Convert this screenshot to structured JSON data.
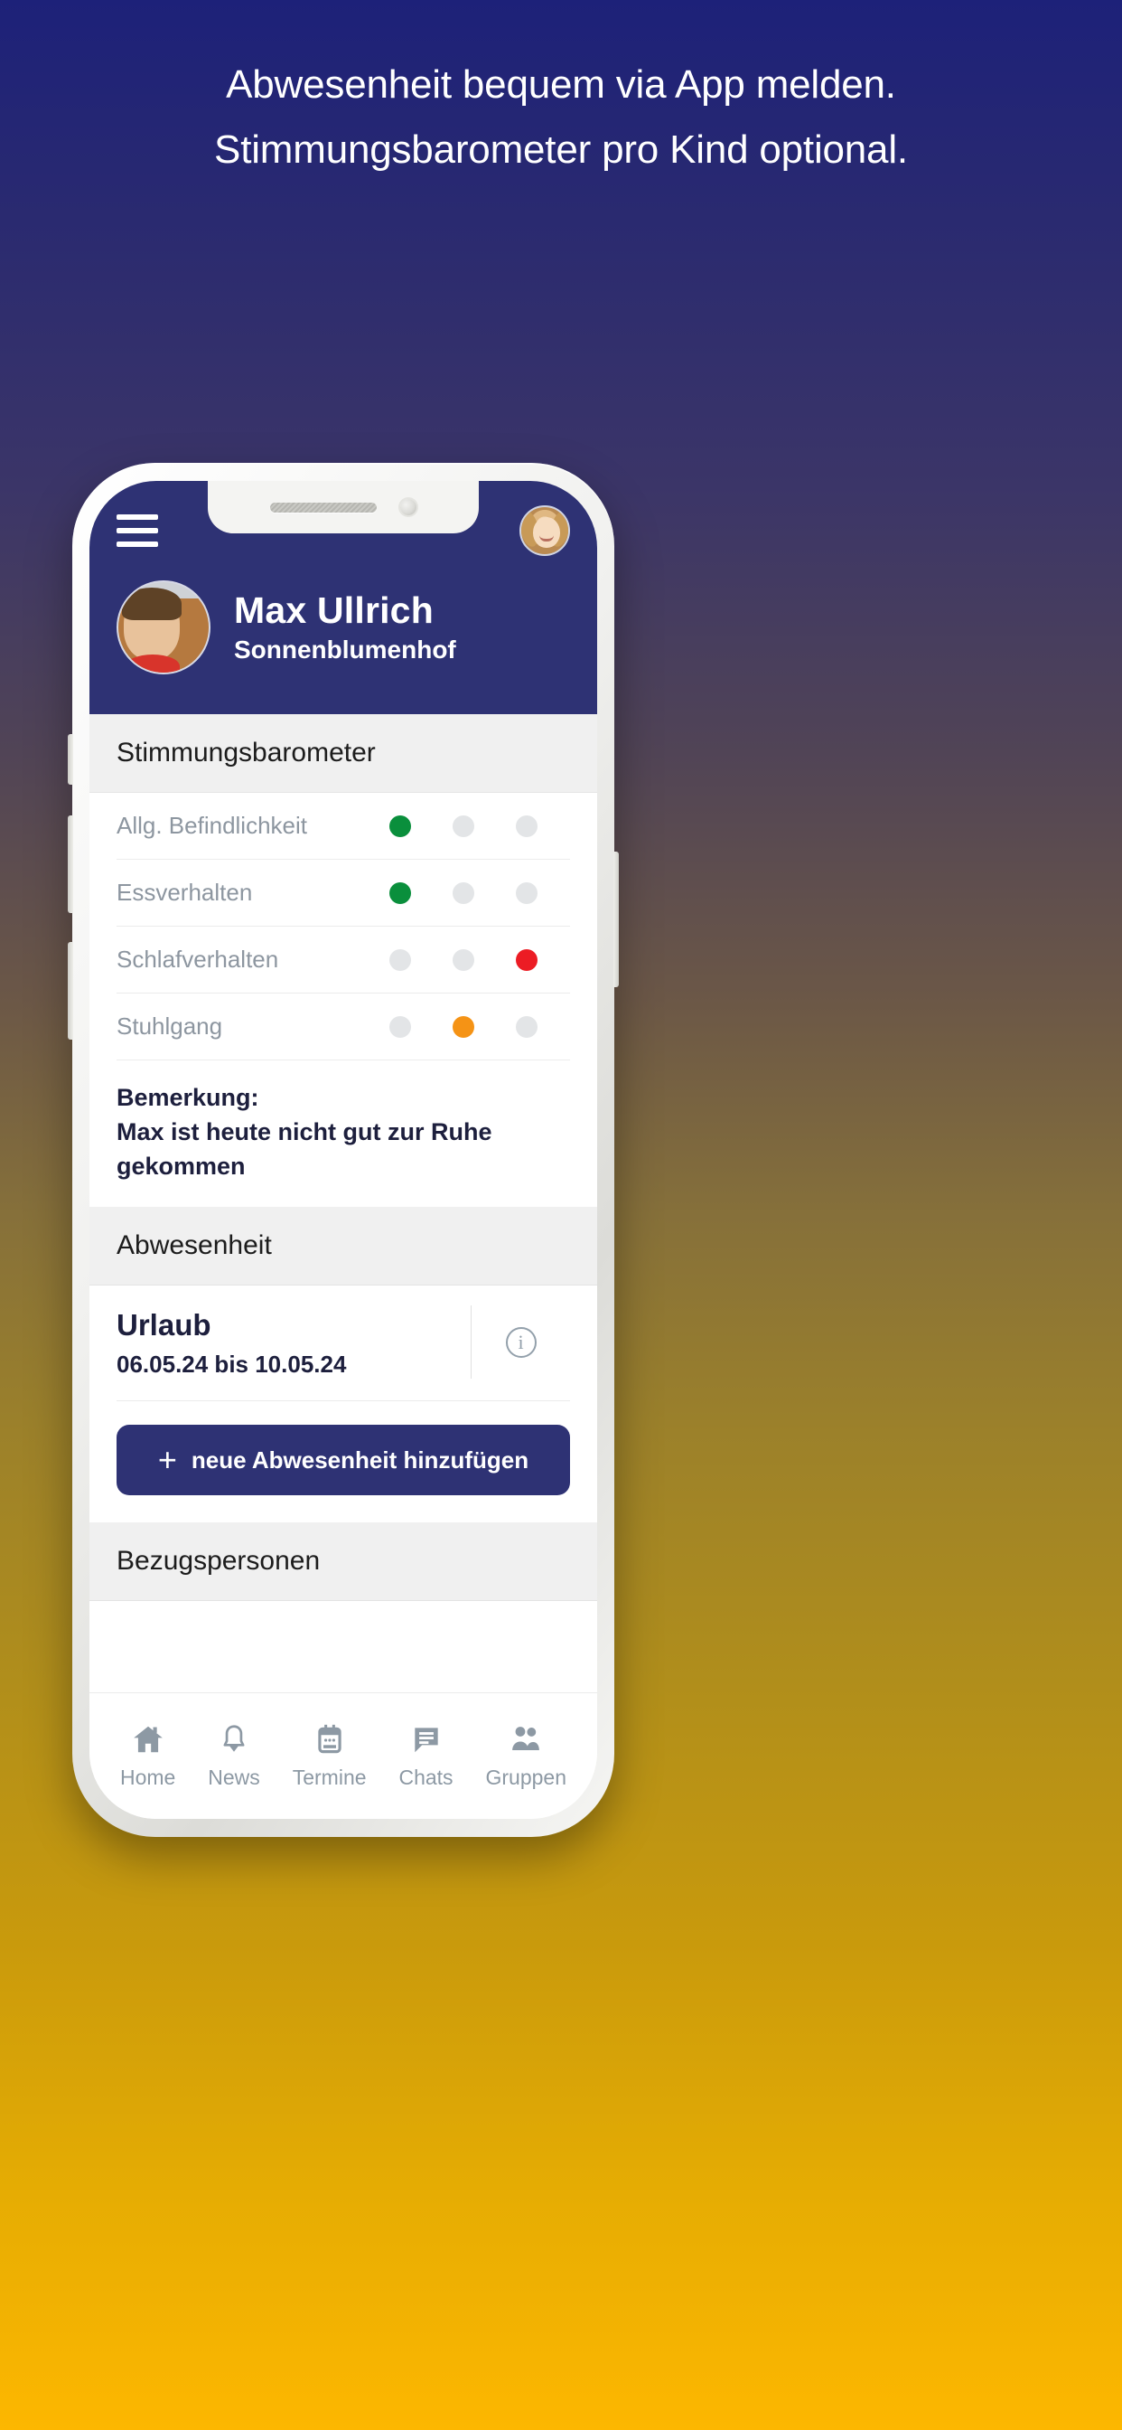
{
  "headline": {
    "line1": "Abwesenheit bequem via App melden.",
    "line2": "Stimmungsbarometer pro Kind optional."
  },
  "colors": {
    "brand_blue": "#2e3274",
    "gradient_top": "#1d2179",
    "gradient_bottom": "#fdb700",
    "green": "#0a8f3c",
    "orange": "#f59315",
    "red": "#ec1c24",
    "dot_inactive": "#e3e5e7",
    "section_bg": "#f0f0f0"
  },
  "app": {
    "menu_icon": "hamburger-icon",
    "user_avatar_icon": "user-avatar",
    "child": {
      "avatar_icon": "child-avatar",
      "name": "Max Ullrich",
      "group": "Sonnenblumenhof"
    },
    "mood": {
      "section_title": "Stimmungsbarometer",
      "rows": [
        {
          "label": "Allg. Befindlichkeit",
          "states": [
            "green",
            "inactive",
            "inactive"
          ]
        },
        {
          "label": "Essverhalten",
          "states": [
            "green",
            "inactive",
            "inactive"
          ]
        },
        {
          "label": "Schlafverhalten",
          "states": [
            "inactive",
            "inactive",
            "red"
          ]
        },
        {
          "label": "Stuhlgang",
          "states": [
            "inactive",
            "orange",
            "inactive"
          ]
        }
      ],
      "remark_label": "Bemerkung:",
      "remark_text": "Max ist heute nicht gut zur Ruhe gekommen"
    },
    "absence": {
      "section_title": "Abwesenheit",
      "entries": [
        {
          "title": "Urlaub",
          "dates": "06.05.24 bis 10.05.24",
          "info_icon": "info-icon"
        }
      ],
      "add_button": {
        "plus": "+",
        "label": "neue Abwesenheit hinzufügen"
      }
    },
    "contacts": {
      "section_title": "Bezugspersonen"
    },
    "bottom_nav": [
      {
        "label": "Home",
        "icon": "home-icon"
      },
      {
        "label": "News",
        "icon": "bell-icon"
      },
      {
        "label": "Termine",
        "icon": "calendar-icon"
      },
      {
        "label": "Chats",
        "icon": "chat-bubble-icon"
      },
      {
        "label": "Gruppen",
        "icon": "people-icon"
      }
    ]
  }
}
